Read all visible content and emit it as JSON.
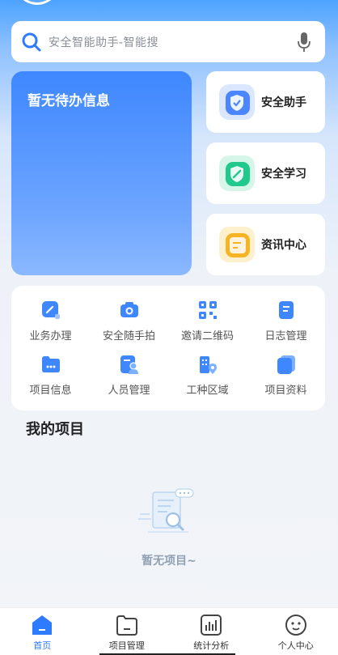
{
  "search": {
    "placeholder": "安全智能助手-智能搜"
  },
  "todo": {
    "title": "暂无待办信息"
  },
  "quick_actions": [
    {
      "label": "安全助手",
      "icon": "shield-check-icon",
      "color": "#3a7bff"
    },
    {
      "label": "安全学习",
      "icon": "pencil-shield-icon",
      "color": "#1fc98a"
    },
    {
      "label": "资讯中心",
      "icon": "news-icon",
      "color": "#f5b020"
    }
  ],
  "grid": [
    {
      "label": "业务办理",
      "icon": "edit-icon"
    },
    {
      "label": "安全随手拍",
      "icon": "camera-icon"
    },
    {
      "label": "邀请二维码",
      "icon": "qrcode-icon"
    },
    {
      "label": "日志管理",
      "icon": "notebook-icon"
    },
    {
      "label": "项目信息",
      "icon": "folder-icon"
    },
    {
      "label": "人员管理",
      "icon": "user-card-icon"
    },
    {
      "label": "工种区域",
      "icon": "building-location-icon"
    },
    {
      "label": "项目资料",
      "icon": "documents-icon"
    }
  ],
  "projects": {
    "title": "我的项目",
    "empty_text": "暂无项目~"
  },
  "tabs": [
    {
      "label": "首页",
      "icon": "home-icon",
      "active": true
    },
    {
      "label": "项目管理",
      "icon": "folder-icon",
      "active": false
    },
    {
      "label": "统计分析",
      "icon": "chart-icon",
      "active": false
    },
    {
      "label": "个人中心",
      "icon": "face-icon",
      "active": false
    }
  ],
  "colors": {
    "primary": "#2f7bff",
    "accent_blue": "#3e87ff"
  }
}
